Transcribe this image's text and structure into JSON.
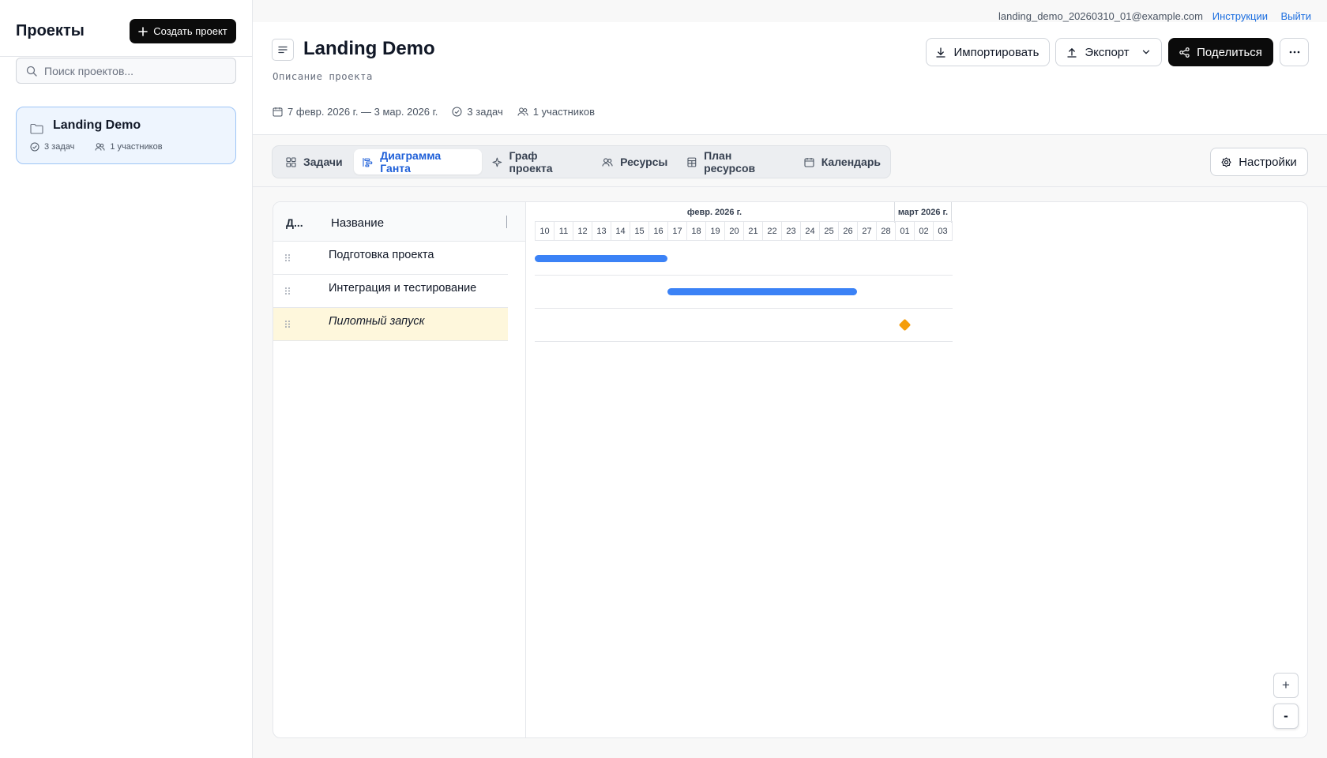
{
  "sidebar": {
    "title": "Проекты",
    "create_label": "Создать проект",
    "search_placeholder": "Поиск проектов...",
    "project": {
      "name": "Landing Demo",
      "tasks": "3 задач",
      "members": "1 участников"
    }
  },
  "topbar": {
    "email": "landing_demo_20260310_01@example.com",
    "instructions": "Инструкции",
    "logout": "Выйти"
  },
  "header": {
    "title": "Landing Demo",
    "description": "Описание проекта",
    "date_range": "7 февр. 2026 г. — 3 мар. 2026 г.",
    "tasks": "3 задач",
    "members": "1 участников",
    "import_label": "Импортировать",
    "export_label": "Экспорт",
    "share_label": "Поделиться"
  },
  "tabs": [
    {
      "label": "Задачи",
      "icon": "grid-icon",
      "active": false
    },
    {
      "label": "Диаграмма Ганта",
      "icon": "gantt-icon",
      "active": true
    },
    {
      "label": "Граф проекта",
      "icon": "sparkle-icon",
      "active": false
    },
    {
      "label": "Ресурсы",
      "icon": "users-icon",
      "active": false
    },
    {
      "label": "План ресурсов",
      "icon": "table-icon",
      "active": false
    },
    {
      "label": "Календарь",
      "icon": "calendar-icon",
      "active": false
    }
  ],
  "settings_label": "Настройки",
  "gantt": {
    "col_d": "Д...",
    "col_name": "Название",
    "months": [
      {
        "label": "февр. 2026 г.",
        "days": 19
      },
      {
        "label": "март 2026 г.",
        "days": 3
      }
    ],
    "days": [
      "10",
      "11",
      "12",
      "13",
      "14",
      "15",
      "16",
      "17",
      "18",
      "19",
      "20",
      "21",
      "22",
      "23",
      "24",
      "25",
      "26",
      "27",
      "28",
      "01",
      "02",
      "03"
    ],
    "tasks": [
      {
        "name": "Подготовка проекта",
        "type": "task",
        "start": "2026-02-10",
        "end": "2026-02-16"
      },
      {
        "name": "Интеграция и тестирование",
        "type": "task",
        "start": "2026-02-17",
        "end": "2026-02-26"
      },
      {
        "name": "Пилотный запуск",
        "type": "milestone",
        "start": "2026-03-01",
        "end": "2026-03-01"
      }
    ],
    "bar_color": "#3b82f6",
    "milestone_color": "#f59e0b",
    "highlight_color": "#fef7dc"
  },
  "zoom": {
    "in": "+",
    "out": "-"
  },
  "colors": {
    "accent": "#1e5fd8",
    "link": "#1d6fe0",
    "primary_button": "#0b0b0b"
  }
}
